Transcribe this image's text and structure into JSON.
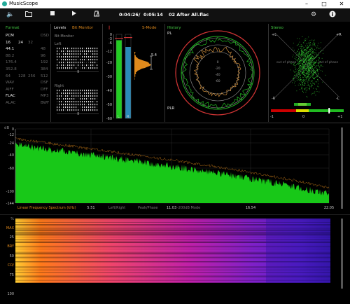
{
  "window": {
    "title": "MusicScope",
    "controls": [
      "minimize",
      "maximize",
      "close"
    ]
  },
  "toolbar": {
    "elapsed": "0:04:26",
    "separator": "/",
    "duration": "0:05:14",
    "track": "02 After All.flac",
    "icons": [
      "volume-icon",
      "folder-icon",
      "stop-icon",
      "play-icon",
      "metronome-icon",
      "settings-icon",
      "info-icon"
    ]
  },
  "format": {
    "title": "Format",
    "rows": [
      [
        "PCM",
        "",
        "",
        "DSD"
      ],
      [
        "16",
        "24",
        "32",
        ""
      ],
      [
        "44.1",
        "",
        "",
        "48"
      ],
      [
        "88.2",
        "",
        "",
        "96"
      ],
      [
        "176.4",
        "",
        "",
        "192"
      ],
      [
        "352.8",
        "",
        "",
        "384"
      ],
      [
        "64",
        "128",
        "256",
        "512"
      ],
      [
        "WAV",
        "",
        "",
        "DSF"
      ],
      [
        "AIFF",
        "",
        "",
        "DFF"
      ],
      [
        "FLAC",
        "",
        "",
        "MP3"
      ],
      [
        "ALAC",
        "",
        "",
        "BWF"
      ]
    ]
  },
  "levels": {
    "title": "Levels",
    "mode": "Bit Monitor",
    "sub": "Bit Monitor",
    "left": "Left",
    "right": "Right",
    "meter_title": "S-Mode",
    "peak_value": "5.4",
    "scale": [
      "0",
      "-3",
      "-6",
      "-12",
      "-20",
      "-30",
      "-40",
      "-50",
      "-60"
    ],
    "meter_labels": [
      "L",
      "R"
    ],
    "level_left": 0.93,
    "level_right": 0.85
  },
  "history": {
    "title": "History",
    "labels": [
      "PL",
      "PLR"
    ],
    "rings": [
      "0",
      "-20",
      "-40",
      "-60"
    ]
  },
  "stereo": {
    "title": "Stereo",
    "corners": [
      "+L",
      "+R",
      "-R",
      "-L"
    ],
    "phase_left": "out of phase",
    "phase_right": "out of phase",
    "corr_labels": [
      "-1",
      "0",
      "+1"
    ],
    "correlation": 0.6
  },
  "spectrum": {
    "db_label": "dB",
    "y_ticks": [
      "0",
      "-12",
      "-24",
      "-40",
      "-60",
      "-100",
      "-144"
    ],
    "x_ticks": [
      "5.51",
      "11.03",
      "16.54",
      "22.05"
    ],
    "mode_labels": [
      "Linear Frequency Spectrum (kHz)",
      "Left/Right",
      "Peak/Phase",
      "-200dB Mode"
    ]
  },
  "spectrogram": {
    "y_ticks": [
      "%",
      "MAX",
      "25",
      "BRY",
      "50",
      "CO/",
      "75",
      "100"
    ]
  },
  "colors": {
    "accent_green": "#22cc22",
    "accent_orange": "#e08a1c",
    "panel_bg": "#000000",
    "meter_blue": "#2a8ab8"
  }
}
